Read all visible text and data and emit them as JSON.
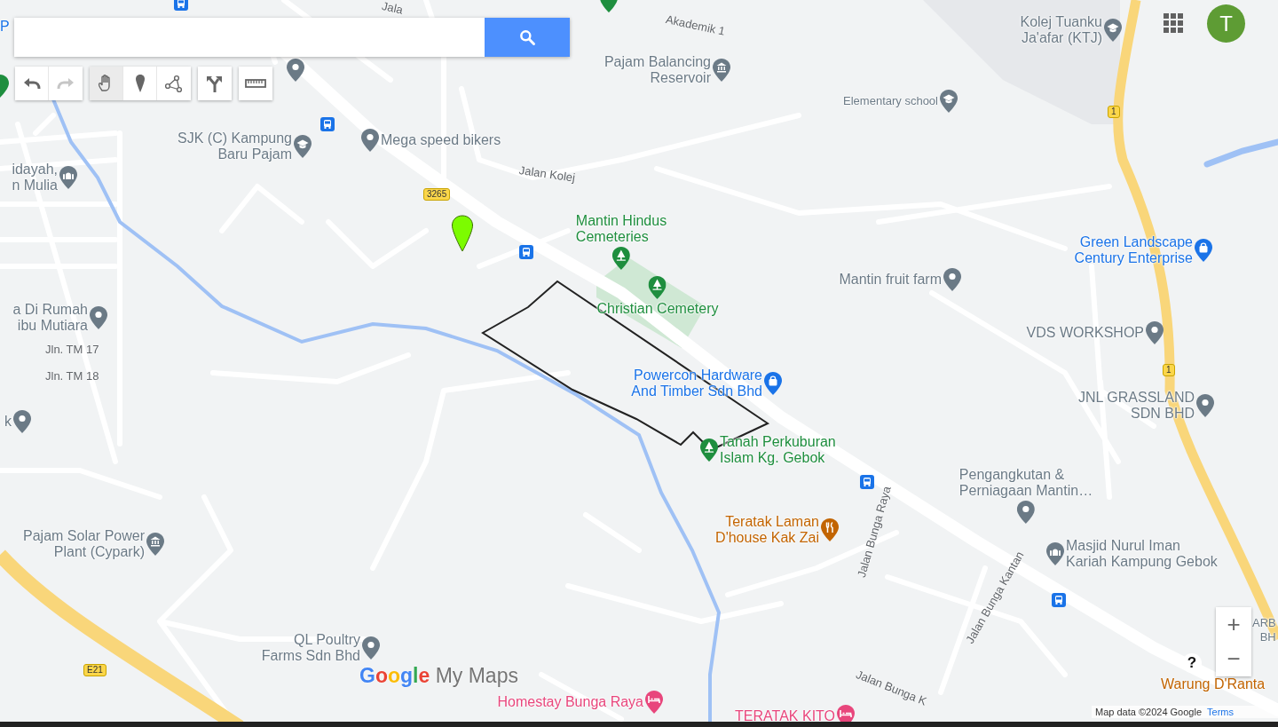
{
  "toolbar": {
    "history": [
      {
        "kind": "undo",
        "disabled": false
      },
      {
        "kind": "redo",
        "disabled": true
      }
    ],
    "tools": [
      {
        "kind": "hand",
        "selected": true
      },
      {
        "kind": "marker",
        "selected": false
      },
      {
        "kind": "line",
        "selected": false
      }
    ],
    "extras": [
      {
        "kind": "directions"
      },
      {
        "kind": "ruler"
      }
    ]
  },
  "account": {
    "initial": "T"
  },
  "places": [
    {
      "label": "P",
      "color": "#1a73e8"
    },
    {
      "label": "SJK (C) Kampung\nBaru Pajam",
      "color": "#6b7a86"
    },
    {
      "label": "Mega speed bikers",
      "color": "#6b7a86"
    },
    {
      "label": "Pajam Balancing\nReservoir",
      "color": "#6b7a86"
    },
    {
      "label": "Kolej Tuanku\nJa'afar (KTJ)",
      "color": "#6b7a86"
    },
    {
      "label": "Elementary school",
      "color": "#6b7a86"
    },
    {
      "label": "idayah,\nn Mulia",
      "color": "#6b7a86"
    },
    {
      "label": "Mantin Hindus\nCemeteries",
      "color": "#1e8e3e"
    },
    {
      "label": "Christian Cemetery",
      "color": "#1e8e3e"
    },
    {
      "label": "Green Landscape\nCentury Enterprise",
      "color": "#1a73e8"
    },
    {
      "label": "Mantin fruit farm",
      "color": "#6b7a86"
    },
    {
      "label": "a Di Rumah\nibu Mutiara",
      "color": "#6b7a86"
    },
    {
      "label": "VDS WORKSHOP",
      "color": "#6b7a86"
    },
    {
      "label": "Powercon Hardware\nAnd Timber Sdn Bhd",
      "color": "#1a73e8"
    },
    {
      "label": "JNL GRASSLAND\nSDN BHD",
      "color": "#6b7a86"
    },
    {
      "label": "k",
      "color": "#6b7a86"
    },
    {
      "label": "Tanah Perkuburan\nIslam Kg. Gebok",
      "color": "#1e8e3e"
    },
    {
      "label": "Pengangkutan &\nPerniagaan Mantin…",
      "color": "#6b7a86"
    },
    {
      "label": "Teratak Laman\nD'house Kak Zai",
      "color": "#c26401"
    },
    {
      "label": "Pajam Solar Power\nPlant (Cypark)",
      "color": "#6b7a86"
    },
    {
      "label": "Masjid Nurul Iman\nKariah Kampung Gebok",
      "color": "#6b7a86"
    },
    {
      "label": "QL Poultry\nFarms Sdn Bhd",
      "color": "#6b7a86"
    },
    {
      "label": "Homestay Bunga Raya",
      "color": "#e8467c"
    },
    {
      "label": "TERATAK KITO",
      "color": "#e8467c"
    },
    {
      "label": "Warung D'Ranta",
      "color": "#c26401"
    },
    {
      "label": "ARB\nBH",
      "color": "#6b7a86"
    }
  ],
  "road_labels": [
    "Jala",
    "Akademik 1",
    "Jalan Kolej",
    "Jln. TM 17",
    "Jln. TM 18",
    "Jalan Bunga Raya",
    "Jalan Bunga Kantan",
    "Jalan Bunga K"
  ],
  "route_shields": [
    "3265",
    "1",
    "1",
    "E21"
  ],
  "logo": {
    "brand": "Google",
    "product": "My Maps"
  },
  "zoom": {
    "in": "+",
    "out": "−"
  },
  "help": "?",
  "attribution": {
    "text": "Map data ©2024 Google",
    "link": "Terms"
  }
}
